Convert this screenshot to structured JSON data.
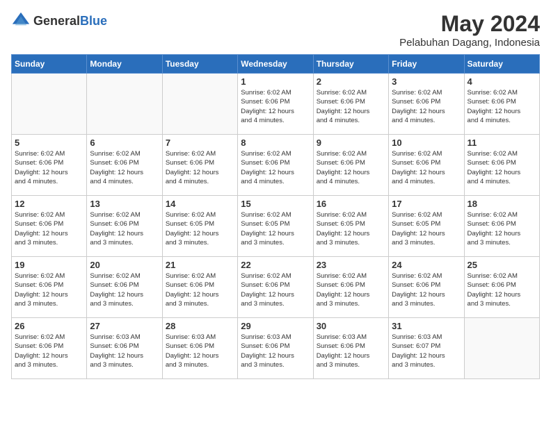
{
  "header": {
    "logo_general": "General",
    "logo_blue": "Blue",
    "month": "May 2024",
    "location": "Pelabuhan Dagang, Indonesia"
  },
  "weekdays": [
    "Sunday",
    "Monday",
    "Tuesday",
    "Wednesday",
    "Thursday",
    "Friday",
    "Saturday"
  ],
  "weeks": [
    [
      {
        "day": "",
        "info": ""
      },
      {
        "day": "",
        "info": ""
      },
      {
        "day": "",
        "info": ""
      },
      {
        "day": "1",
        "info": "Sunrise: 6:02 AM\nSunset: 6:06 PM\nDaylight: 12 hours\nand 4 minutes."
      },
      {
        "day": "2",
        "info": "Sunrise: 6:02 AM\nSunset: 6:06 PM\nDaylight: 12 hours\nand 4 minutes."
      },
      {
        "day": "3",
        "info": "Sunrise: 6:02 AM\nSunset: 6:06 PM\nDaylight: 12 hours\nand 4 minutes."
      },
      {
        "day": "4",
        "info": "Sunrise: 6:02 AM\nSunset: 6:06 PM\nDaylight: 12 hours\nand 4 minutes."
      }
    ],
    [
      {
        "day": "5",
        "info": "Sunrise: 6:02 AM\nSunset: 6:06 PM\nDaylight: 12 hours\nand 4 minutes."
      },
      {
        "day": "6",
        "info": "Sunrise: 6:02 AM\nSunset: 6:06 PM\nDaylight: 12 hours\nand 4 minutes."
      },
      {
        "day": "7",
        "info": "Sunrise: 6:02 AM\nSunset: 6:06 PM\nDaylight: 12 hours\nand 4 minutes."
      },
      {
        "day": "8",
        "info": "Sunrise: 6:02 AM\nSunset: 6:06 PM\nDaylight: 12 hours\nand 4 minutes."
      },
      {
        "day": "9",
        "info": "Sunrise: 6:02 AM\nSunset: 6:06 PM\nDaylight: 12 hours\nand 4 minutes."
      },
      {
        "day": "10",
        "info": "Sunrise: 6:02 AM\nSunset: 6:06 PM\nDaylight: 12 hours\nand 4 minutes."
      },
      {
        "day": "11",
        "info": "Sunrise: 6:02 AM\nSunset: 6:06 PM\nDaylight: 12 hours\nand 4 minutes."
      }
    ],
    [
      {
        "day": "12",
        "info": "Sunrise: 6:02 AM\nSunset: 6:06 PM\nDaylight: 12 hours\nand 3 minutes."
      },
      {
        "day": "13",
        "info": "Sunrise: 6:02 AM\nSunset: 6:06 PM\nDaylight: 12 hours\nand 3 minutes."
      },
      {
        "day": "14",
        "info": "Sunrise: 6:02 AM\nSunset: 6:05 PM\nDaylight: 12 hours\nand 3 minutes."
      },
      {
        "day": "15",
        "info": "Sunrise: 6:02 AM\nSunset: 6:05 PM\nDaylight: 12 hours\nand 3 minutes."
      },
      {
        "day": "16",
        "info": "Sunrise: 6:02 AM\nSunset: 6:05 PM\nDaylight: 12 hours\nand 3 minutes."
      },
      {
        "day": "17",
        "info": "Sunrise: 6:02 AM\nSunset: 6:05 PM\nDaylight: 12 hours\nand 3 minutes."
      },
      {
        "day": "18",
        "info": "Sunrise: 6:02 AM\nSunset: 6:06 PM\nDaylight: 12 hours\nand 3 minutes."
      }
    ],
    [
      {
        "day": "19",
        "info": "Sunrise: 6:02 AM\nSunset: 6:06 PM\nDaylight: 12 hours\nand 3 minutes."
      },
      {
        "day": "20",
        "info": "Sunrise: 6:02 AM\nSunset: 6:06 PM\nDaylight: 12 hours\nand 3 minutes."
      },
      {
        "day": "21",
        "info": "Sunrise: 6:02 AM\nSunset: 6:06 PM\nDaylight: 12 hours\nand 3 minutes."
      },
      {
        "day": "22",
        "info": "Sunrise: 6:02 AM\nSunset: 6:06 PM\nDaylight: 12 hours\nand 3 minutes."
      },
      {
        "day": "23",
        "info": "Sunrise: 6:02 AM\nSunset: 6:06 PM\nDaylight: 12 hours\nand 3 minutes."
      },
      {
        "day": "24",
        "info": "Sunrise: 6:02 AM\nSunset: 6:06 PM\nDaylight: 12 hours\nand 3 minutes."
      },
      {
        "day": "25",
        "info": "Sunrise: 6:02 AM\nSunset: 6:06 PM\nDaylight: 12 hours\nand 3 minutes."
      }
    ],
    [
      {
        "day": "26",
        "info": "Sunrise: 6:02 AM\nSunset: 6:06 PM\nDaylight: 12 hours\nand 3 minutes."
      },
      {
        "day": "27",
        "info": "Sunrise: 6:03 AM\nSunset: 6:06 PM\nDaylight: 12 hours\nand 3 minutes."
      },
      {
        "day": "28",
        "info": "Sunrise: 6:03 AM\nSunset: 6:06 PM\nDaylight: 12 hours\nand 3 minutes."
      },
      {
        "day": "29",
        "info": "Sunrise: 6:03 AM\nSunset: 6:06 PM\nDaylight: 12 hours\nand 3 minutes."
      },
      {
        "day": "30",
        "info": "Sunrise: 6:03 AM\nSunset: 6:06 PM\nDaylight: 12 hours\nand 3 minutes."
      },
      {
        "day": "31",
        "info": "Sunrise: 6:03 AM\nSunset: 6:07 PM\nDaylight: 12 hours\nand 3 minutes."
      },
      {
        "day": "",
        "info": ""
      }
    ]
  ]
}
